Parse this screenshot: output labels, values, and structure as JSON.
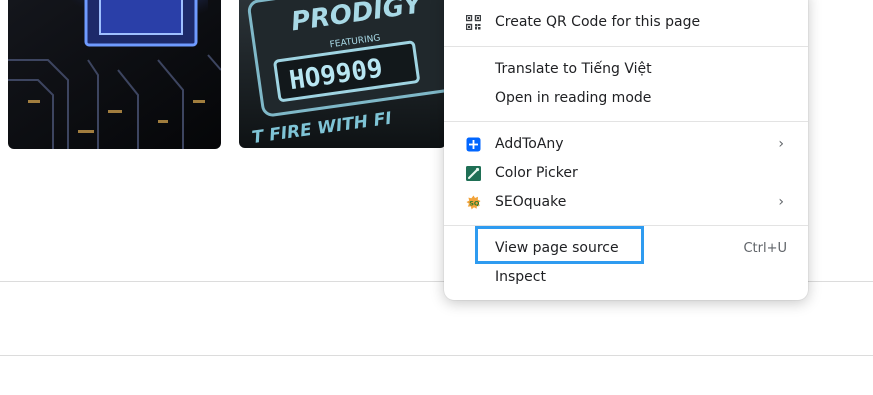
{
  "context_menu": {
    "items": [
      {
        "label": "Create QR Code for this page",
        "icon": "qr-code-icon"
      },
      {
        "label": "Translate to Tiếng Việt"
      },
      {
        "label": "Open in reading mode"
      },
      {
        "label": "AddToAny",
        "icon": "addtoany-icon",
        "submenu_indicator": "›"
      },
      {
        "label": "Color Picker",
        "icon": "color-picker-icon"
      },
      {
        "label": "SEOquake",
        "icon": "seoquake-icon",
        "submenu_indicator": "›"
      },
      {
        "label": "View page source",
        "shortcut": "Ctrl+U"
      },
      {
        "label": "Inspect"
      }
    ]
  },
  "thumbnails": [
    {
      "name": "circuit-chip-image"
    },
    {
      "name": "prodigy-label-image",
      "text_top": "PRODIGY",
      "text_feat": "FEATURING",
      "text_code": "HO9909",
      "text_bottom": "T FIRE WITH FI"
    }
  ],
  "highlight": {
    "target": "View page source",
    "color": "#2e9bf0"
  }
}
